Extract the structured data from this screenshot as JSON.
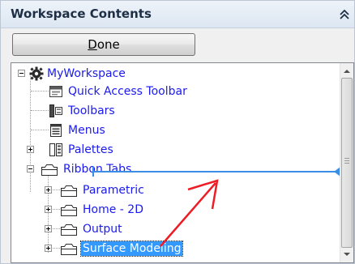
{
  "header": {
    "title": "Workspace Contents",
    "collapse_icon": "double-chevron-up-icon"
  },
  "done_button": {
    "label_underlined": "D",
    "label_rest": "one"
  },
  "tree": {
    "nodes": [
      {
        "label": "MyWorkspace",
        "icon": "gear-icon",
        "expander": "minus"
      },
      {
        "label": "Quick Access Toolbar",
        "icon": "toolbar-icon"
      },
      {
        "label": "Toolbars",
        "icon": "toolbars-icon"
      },
      {
        "label": "Menus",
        "icon": "menu-icon"
      },
      {
        "label": "Palettes",
        "icon": "palette-icon",
        "expander": "plus"
      },
      {
        "label": "Ribbon Tabs",
        "icon": "ribbon-icon",
        "expander": "minus"
      },
      {
        "label": "Parametric",
        "icon": "tab-icon",
        "expander": "plus"
      },
      {
        "label": "Home - 2D",
        "icon": "tab-icon",
        "expander": "plus"
      },
      {
        "label": "Output",
        "icon": "tab-icon",
        "expander": "plus"
      },
      {
        "label": "Surface Modeling",
        "icon": "tab-icon",
        "expander": "plus",
        "selected": true
      }
    ]
  },
  "colors": {
    "label": "#1a1af0",
    "selected_bg": "#3399ff",
    "drop_indicator": "#3a8ee6",
    "annotation_arrow": "#ee1c24"
  }
}
